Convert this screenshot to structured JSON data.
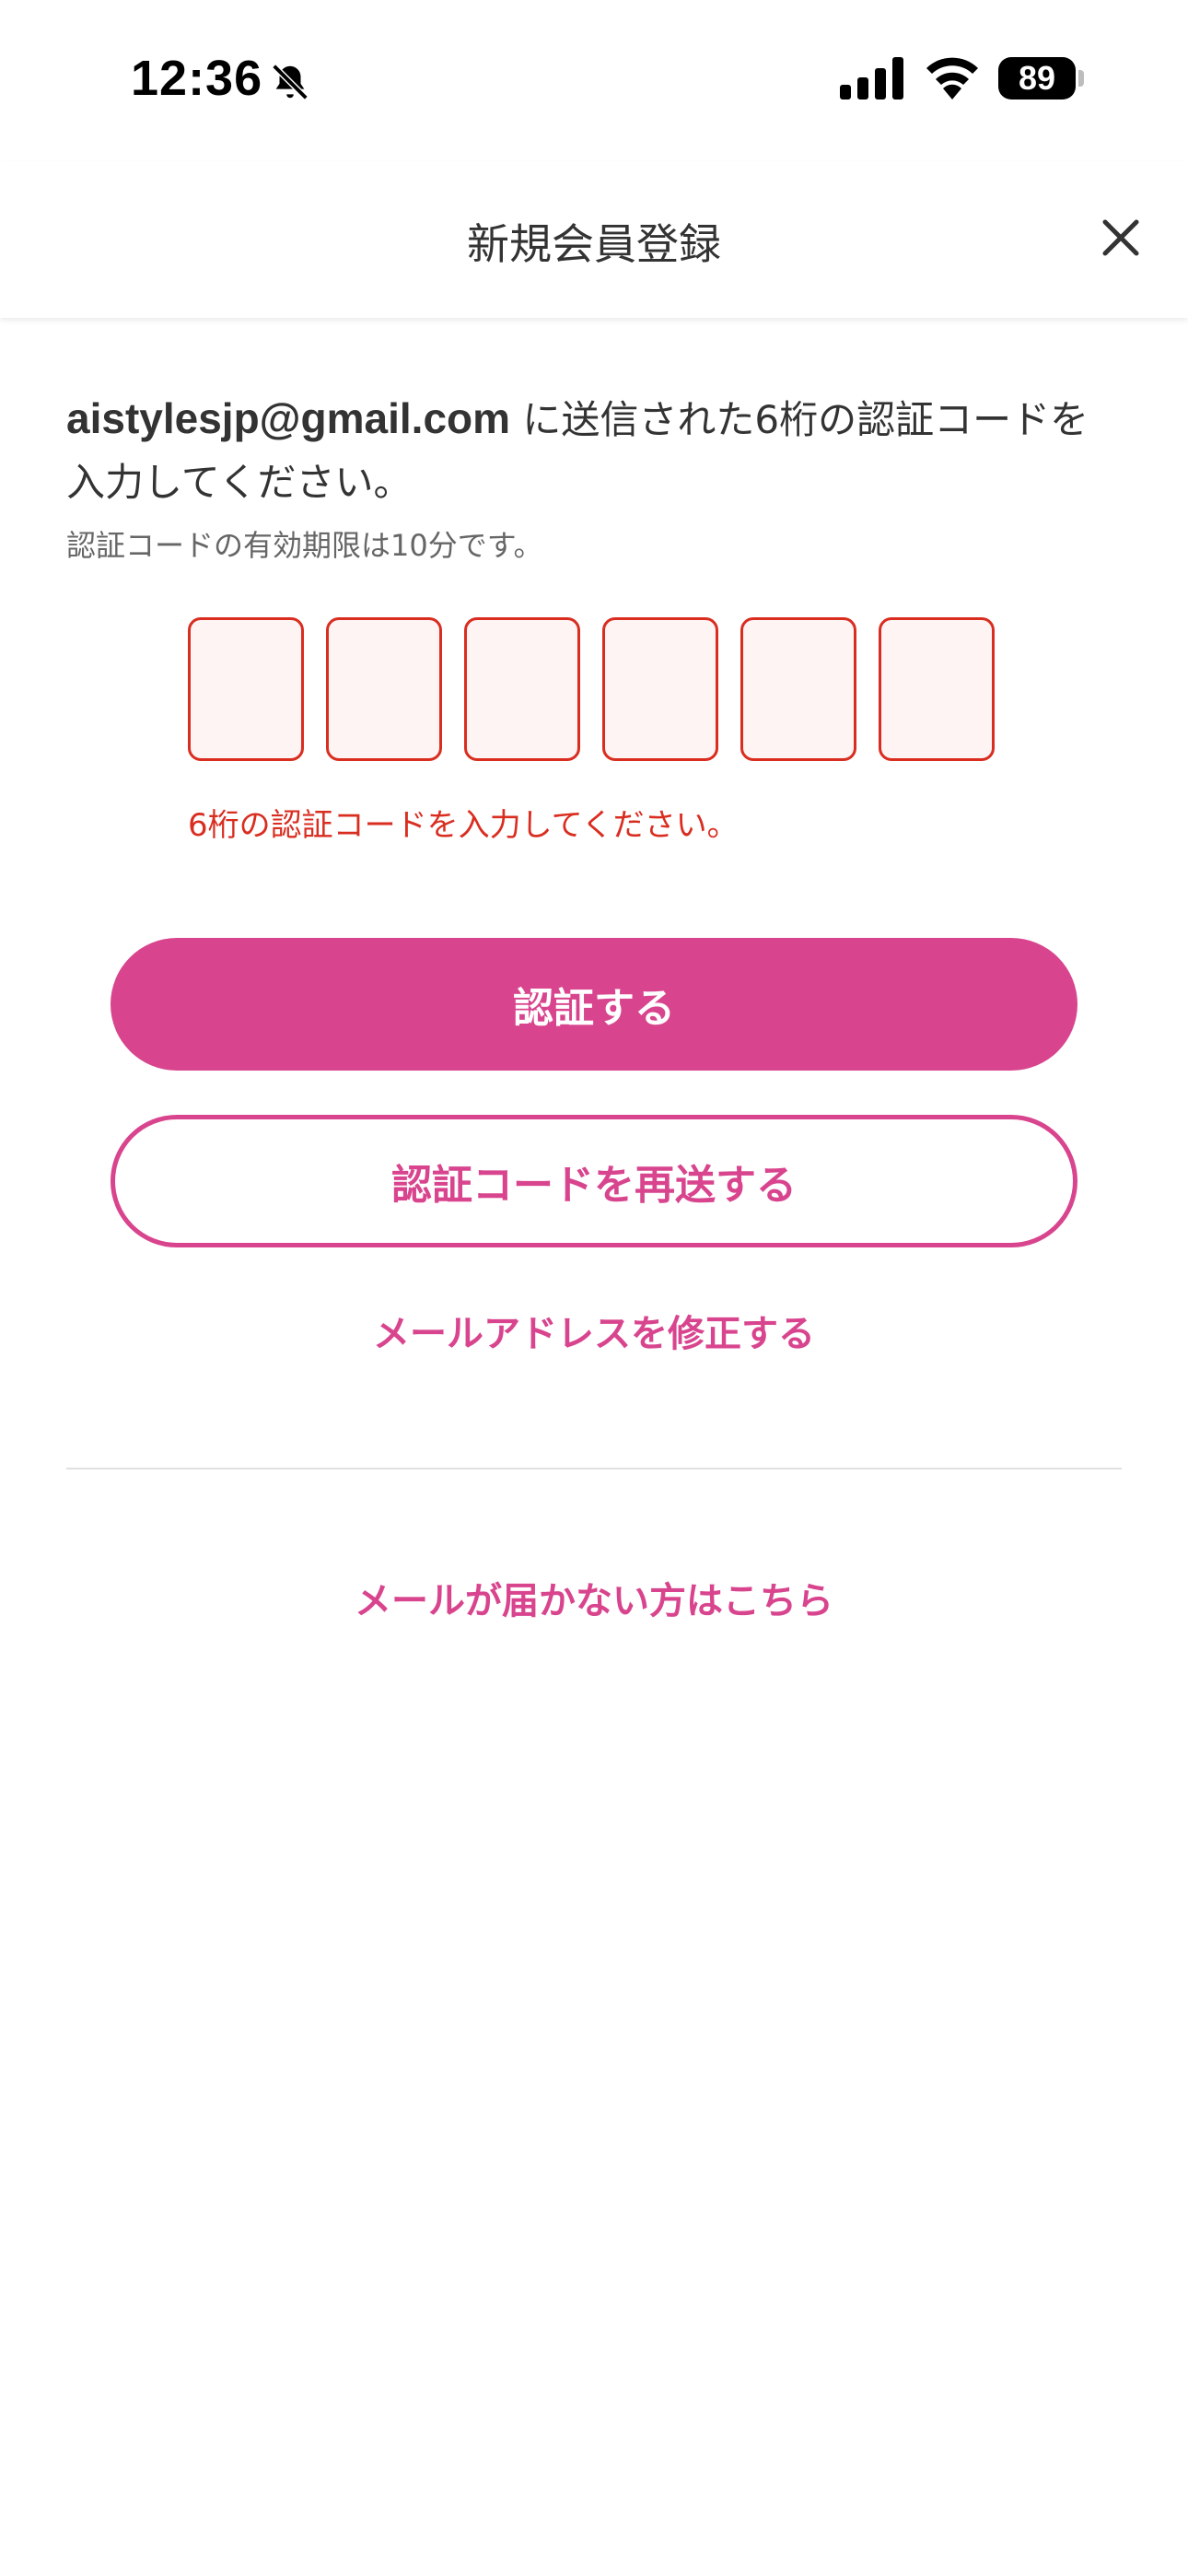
{
  "status_bar": {
    "time": "12:36",
    "battery": "89",
    "icons": [
      "bell-slash-icon",
      "signal-icon",
      "wifi-icon",
      "battery-icon"
    ]
  },
  "header": {
    "title": "新規会員登録",
    "close_icon": "close-icon"
  },
  "verification": {
    "email": "aistylesjp@gmail.com",
    "instruction_suffix": " に送信された6桁の認証コードを入力してください。",
    "expiry_note": "認証コードの有効期限は10分です。",
    "code_digits": [
      "",
      "",
      "",
      "",
      "",
      ""
    ],
    "error_message": "6桁の認証コードを入力してください。"
  },
  "actions": {
    "verify_label": "認証する",
    "resend_label": "認証コードを再送する",
    "edit_email_label": "メールアドレスを修正する",
    "not_received_label": "メールが届かない方はこちら"
  },
  "colors": {
    "accent": "#d8458e",
    "error": "#d92d20",
    "code_box_bg": "#fdf4f3"
  }
}
